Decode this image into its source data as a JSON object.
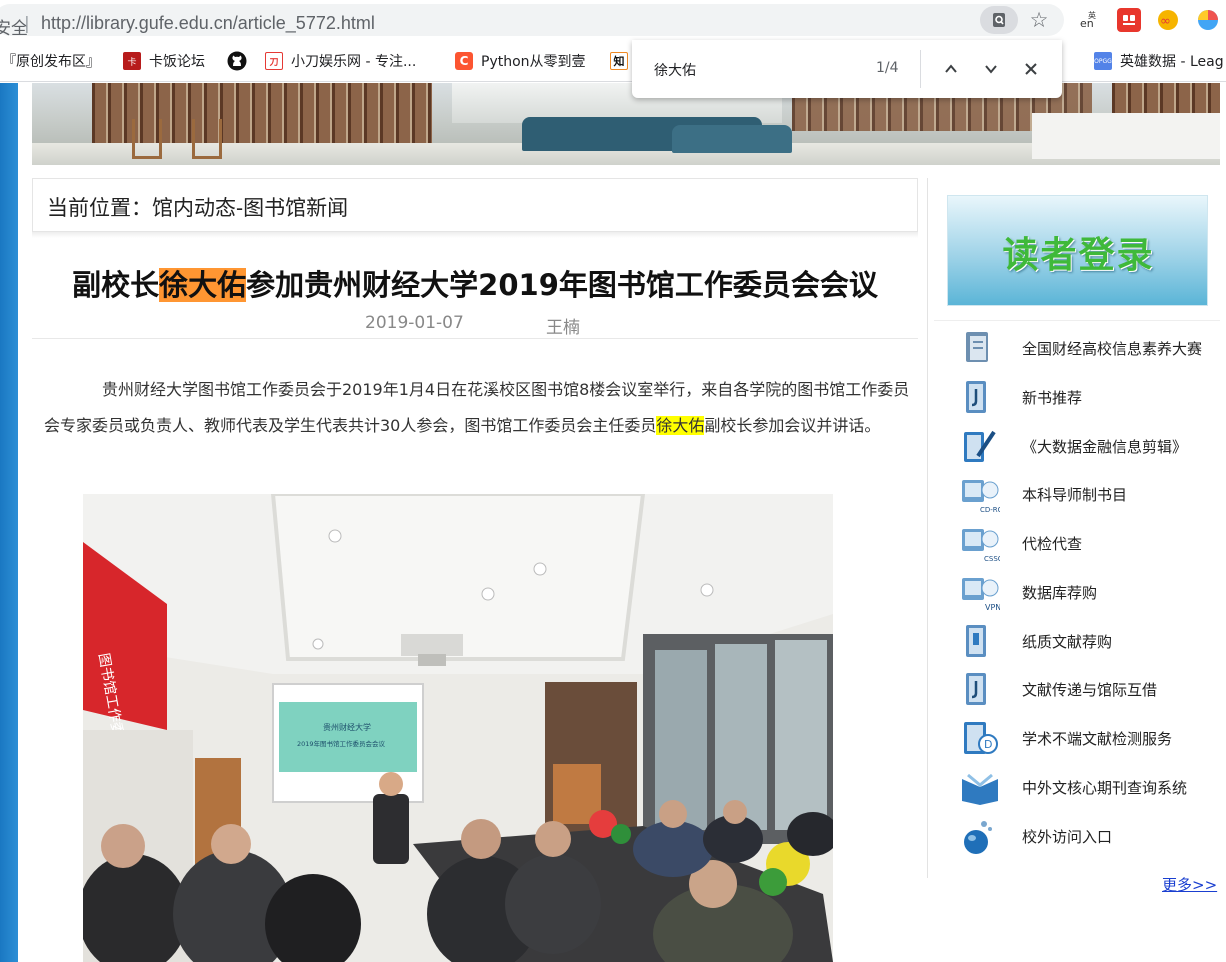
{
  "browser": {
    "security_label": "安全",
    "url": "http://library.gufe.edu.cn/article_5772.html"
  },
  "bookmarks": [
    {
      "label": "『原创发布区』",
      "icon": "bookmark-page-icon"
    },
    {
      "label": "卡饭论坛",
      "icon": "kafan-logo-icon"
    },
    {
      "label": "",
      "icon": "github-icon"
    },
    {
      "label": "小刀娱乐网 - 专注...",
      "icon": "xiaodao-logo-icon"
    },
    {
      "label": "Python从零到壹",
      "icon": "csdn-c-icon"
    },
    {
      "label": "",
      "icon": "zhihu-icon"
    },
    {
      "label": "英雄数据 - Leag",
      "icon": "opgg-icon"
    }
  ],
  "find": {
    "query": "徐大佑",
    "count": "1/4"
  },
  "breadcrumb": "当前位置：馆内动态-图书馆新闻",
  "article": {
    "title_before": "副校长",
    "title_highlight": "徐大佑",
    "title_after": "参加贵州财经大学2019年图书馆工作委员会会议",
    "date": "2019-01-07",
    "author": "王楠",
    "para_before": "贵州财经大学图书馆工作委员会于2019年1月4日在花溪校区图书馆8楼会议室举行，来自各学院的图书馆工作委员会专家委员或负责人、教师代表及学生代表共计30人参会，图书馆工作委员会主任委员",
    "para_highlight": "徐大佑",
    "para_after": "副校长参加会议并讲话。",
    "photo": {
      "banner_text": "图书馆工作委员会会议",
      "screen_line1": "贵州财经大学",
      "screen_line2": "2019年图书馆工作委员会会议"
    }
  },
  "sidebar": {
    "login": "读者登录",
    "items": [
      {
        "label": "全国财经高校信息素养大赛"
      },
      {
        "label": "新书推荐"
      },
      {
        "label": "《大数据金融信息剪辑》"
      },
      {
        "label": "本科导师制书目",
        "badge": "CD-ROM"
      },
      {
        "label": "代检代查",
        "badge": "CSSCI"
      },
      {
        "label": "数据库荐购",
        "badge": "VPN"
      },
      {
        "label": "纸质文献荐购"
      },
      {
        "label": "文献传递与馆际互借"
      },
      {
        "label": "学术不端文献检测服务",
        "badge": "D"
      },
      {
        "label": "中外文核心期刊查询系统"
      },
      {
        "label": "校外访问入口"
      }
    ],
    "more": "更多>>"
  },
  "colors": {
    "highlight_active": "#ff9632",
    "highlight_other": "#ffff00",
    "login_text": "#3fb93a",
    "link": "#1a3fd0"
  }
}
